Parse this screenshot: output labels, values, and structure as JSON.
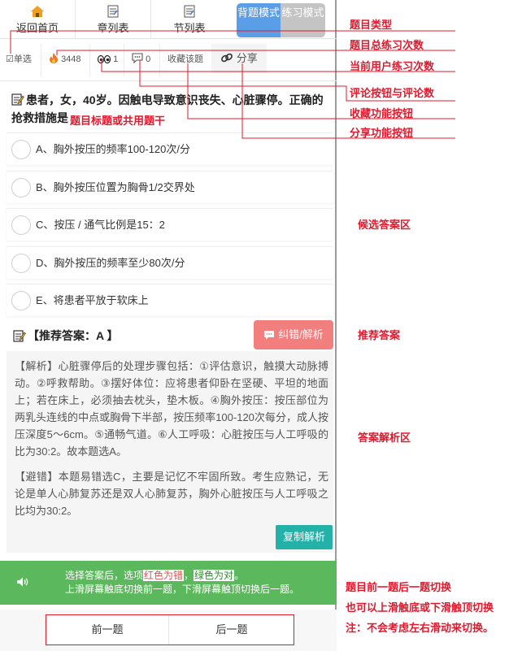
{
  "topnav": {
    "home_label": "返回首页",
    "chapter_label": "章列表",
    "section_label": "节列表",
    "mode_recite": "背题模式",
    "mode_practice": "练习模式"
  },
  "meta": {
    "type_label": "☑单选",
    "total_count": "3448",
    "user_count": "1",
    "comment_count": "0",
    "favorite_label": "收藏该题",
    "share_label": "分享"
  },
  "question": {
    "text": "患者，女，40岁。因触电导致意识丧失、心脏骤停。正确的抢救措施是",
    "options": [
      "A、胸外按压的频率100-120次/分",
      "B、胸外按压位置为胸骨1/2交界处",
      "C、按压 / 通气比例是15：2",
      "D、胸外按压的频率至少80次/分",
      "E、将患者平放于软床上"
    ]
  },
  "answer": {
    "recommended": "【推荐答案：A 】",
    "feedback_label": "纠错/解析",
    "analysis_p1": "【解析】心脏骤停后的处理步骤包括：①评估意识，触摸大动脉搏动。②呼救帮助。③摆好体位：应将患者仰卧在坚硬、平坦的地面上；若在床上，必须抽去枕头，垫木板。④胸外按压：按压部位为两乳头连线的中点或胸骨下半部，按压频率100-120次每分，成人按压深度5～6cm。⑤通畅气道。⑥人工呼吸：心脏按压与人工呼吸的比为30:2。故本题选A。",
    "analysis_p2": "【避错】本题易错选C，主要是记忆不牢固所致。考生应熟记，无论是单人心肺复苏还是双人心肺复苏，胸外心脏按压与人工呼吸之比均为30:2。",
    "copy_label": "复制解析"
  },
  "tip": {
    "line1_prefix": "选择答案后，选项",
    "red_tag": "红色为错",
    "comma": "，",
    "green_tag": "绿色为对",
    "period": "。",
    "line2": "上滑屏幕触底切换前一题，下滑屏幕触顶切换后一题。"
  },
  "bottomnav": {
    "prev_label": "前一题",
    "next_label": "后一题"
  },
  "annotations": {
    "question_type": "题目类型",
    "total_practice": "题目总练习次数",
    "user_practice": "当前用户练习次数",
    "comment": "评论按钮与评论数",
    "favorite": "收藏功能按钮",
    "share": "分享功能按钮",
    "stem": "题目标题或共用题干",
    "options_area": "候选答案区",
    "recommended": "推荐答案",
    "analysis_area": "答案解析区",
    "switch_line1": "题目前一题后一题切换",
    "switch_line2": "也可以上滑触底或下滑触顶切换",
    "switch_line3": "注：不会考虑左右滑动来切换。"
  },
  "colors": {
    "annotation_red": "#e0192d",
    "mode_active": "#5b9ee8",
    "mode_inactive": "#c4c4c4",
    "feedback_red": "#f27e7e",
    "copy_teal": "#23b1a8",
    "tip_green": "#5cb85c"
  }
}
